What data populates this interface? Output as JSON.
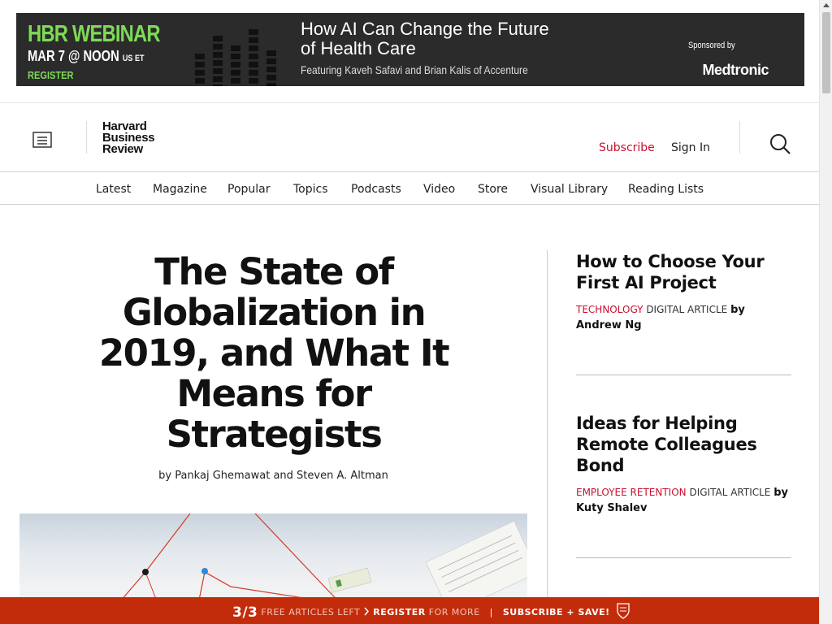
{
  "ad": {
    "webinar_label": "HBR WEBINAR",
    "date": "MAR 7 @ NOON",
    "timezone": "US ET",
    "register": "REGISTER",
    "title_line1": "How AI Can Change the Future",
    "title_line2": "of Health Care",
    "subtitle": "Featuring Kaveh Safavi and Brian Kalis of Accenture",
    "sponsored_by": "Sponsored by",
    "sponsor": "Medtronic",
    "accent_color": "#7ed957"
  },
  "header": {
    "menu_icon": "menu-icon",
    "logo_line1": "Harvard",
    "logo_line2": "Business",
    "logo_line3": "Review",
    "subscribe": "Subscribe",
    "sign_in": "Sign In",
    "search_icon": "search-icon",
    "accent_color": "#c8102e"
  },
  "nav": {
    "items": [
      "Latest",
      "Magazine",
      "Popular",
      "Topics",
      "Podcasts",
      "Video",
      "Store",
      "Visual Library",
      "Reading Lists"
    ]
  },
  "article": {
    "headline": "The State of Globalization in 2019, and What It Means for Strategists",
    "byline": "by Pankaj Ghemawat and Steven A. Altman"
  },
  "sidebar": {
    "items": [
      {
        "title": "How to Choose Your First AI Project",
        "category": "TECHNOLOGY",
        "type": "DIGITAL ARTICLE",
        "author": "by Andrew Ng"
      },
      {
        "title": "Ideas for Helping Remote Colleagues Bond",
        "category": "EMPLOYEE RETENTION",
        "type": "DIGITAL ARTICLE",
        "author": "by Kuty Shalev"
      }
    ]
  },
  "paywall_bar": {
    "count": "3/3",
    "free_left": "FREE ARTICLES LEFT",
    "register": "REGISTER",
    "for_more": "FOR MORE",
    "separator": "|",
    "subscribe": "SUBSCRIBE + SAVE!",
    "background": "#c32c0b"
  }
}
